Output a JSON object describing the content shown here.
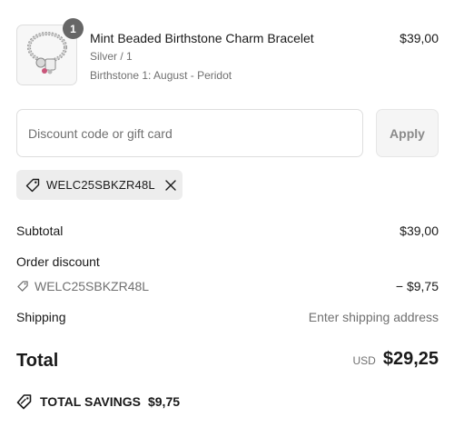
{
  "product": {
    "name": "Mint Beaded Birthstone Charm Bracelet",
    "variant": "Silver / 1",
    "property": "Birthstone 1: August - Peridot",
    "price": "$39,00",
    "quantity": "1"
  },
  "discount": {
    "placeholder": "Discount code or gift card",
    "apply_label": "Apply",
    "applied_code": "WELC25SBKZR48L"
  },
  "summary": {
    "subtotal_label": "Subtotal",
    "subtotal_value": "$39,00",
    "order_discount_label": "Order discount",
    "discount_code": "WELC25SBKZR48L",
    "discount_value": "− $9,75",
    "shipping_label": "Shipping",
    "shipping_value": "Enter shipping address",
    "total_label": "Total",
    "total_currency": "USD",
    "total_value": "$29,25",
    "savings_label": "TOTAL SAVINGS",
    "savings_value": "$9,75"
  },
  "icons": {
    "tag": "tag-icon",
    "close": "close-icon",
    "savings": "savings-tag-icon"
  },
  "colors": {
    "muted_text": "#707070",
    "chip_bg": "#ededed",
    "badge_bg": "#666666"
  }
}
